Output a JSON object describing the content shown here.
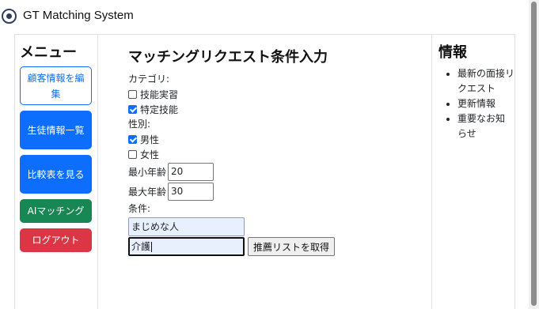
{
  "app": {
    "title": "GT Matching System"
  },
  "sidebar": {
    "heading": "メニュー",
    "buttons": [
      {
        "label": "顧客情報を編集"
      },
      {
        "label": "生徒情報一覧"
      },
      {
        "label": "比較表を見る"
      },
      {
        "label": "AIマッチング"
      },
      {
        "label": "ログアウト"
      }
    ]
  },
  "main": {
    "title": "マッチングリクエスト条件入力",
    "category_label": "カテゴリ:",
    "categories": [
      {
        "label": "技能実習",
        "checked": false
      },
      {
        "label": "特定技能",
        "checked": true
      }
    ],
    "gender_label": "性別:",
    "genders": [
      {
        "label": "男性",
        "checked": true
      },
      {
        "label": "女性",
        "checked": false
      }
    ],
    "min_age_label": "最小年齢",
    "min_age_value": "20",
    "max_age_label": "最大年齢",
    "max_age_value": "30",
    "conditions_label": "条件:",
    "condition_1_value": "まじめな人",
    "condition_2_value": "介護",
    "submit_label": "推薦リストを取得"
  },
  "info": {
    "heading": "情報",
    "items": [
      "最新の面接リクエスト",
      "更新情報",
      "重要なお知らせ"
    ]
  },
  "colors": {
    "primary": "#0d6efd",
    "success": "#198754",
    "danger": "#dc3545"
  }
}
